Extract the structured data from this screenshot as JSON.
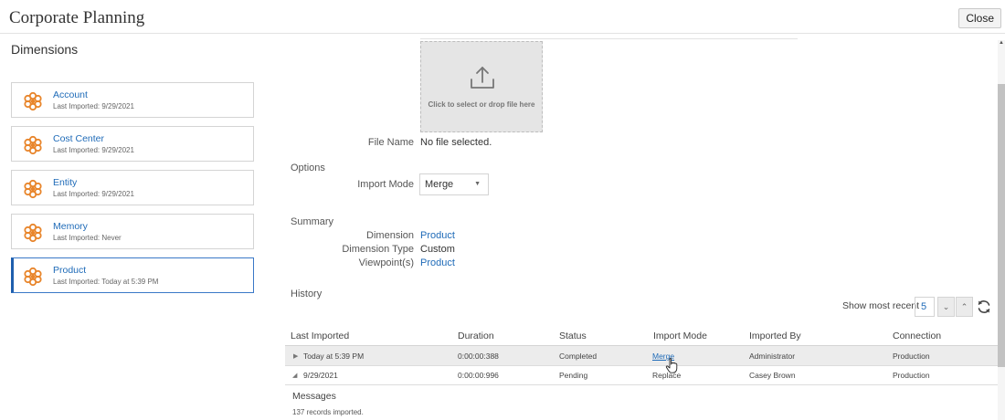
{
  "header": {
    "title": "Corporate Planning",
    "close_label": "Close"
  },
  "dimensions": {
    "heading": "Dimensions",
    "items": [
      {
        "name": "Account",
        "sub": "Last Imported: 9/29/2021"
      },
      {
        "name": "Cost Center",
        "sub": "Last Imported: 9/29/2021"
      },
      {
        "name": "Entity",
        "sub": "Last Imported: 9/29/2021"
      },
      {
        "name": "Memory",
        "sub": "Last Imported: Never"
      },
      {
        "name": "Product",
        "sub": "Last Imported: Today at 5:39 PM"
      }
    ],
    "selected": "Product",
    "icon": "dimension-icon",
    "icon_color": "#e8852b"
  },
  "upload": {
    "dropzone_text": "Click to select or drop file here",
    "icon": "upload-icon",
    "file_name_label": "File Name",
    "file_name_value": "No file selected."
  },
  "options": {
    "heading": "Options",
    "import_mode_label": "Import Mode",
    "import_mode_value": "Merge"
  },
  "summary": {
    "heading": "Summary",
    "dimension_label": "Dimension",
    "dimension_value": "Product",
    "type_label": "Dimension Type",
    "type_value": "Custom",
    "viewpoints_label": "Viewpoint(s)",
    "viewpoints_value": "Product"
  },
  "history": {
    "heading": "History",
    "show_recent_label": "Show most recent",
    "show_recent_value": "5",
    "columns": [
      "Last Imported",
      "Duration",
      "Status",
      "Import Mode",
      "Imported By",
      "Connection"
    ],
    "rows": [
      {
        "expander": "▶",
        "last_imported": "Today at 5:39 PM",
        "duration": "0:00:00:388",
        "status": "Completed",
        "import_mode": "Merge",
        "imported_by": "Administrator",
        "connection": "Production"
      },
      {
        "expander": "◢",
        "last_imported": "9/29/2021",
        "duration": "0:00:00:996",
        "status": "Pending",
        "import_mode": "Replace",
        "imported_by": "Casey Brown",
        "connection": "Production"
      }
    ],
    "messages_heading": "Messages",
    "messages_text": "137 records imported."
  },
  "colors": {
    "accent": "#1f6bb8",
    "selected_border": "#1f5fae",
    "dropzone_bg": "#e5e5e5"
  }
}
